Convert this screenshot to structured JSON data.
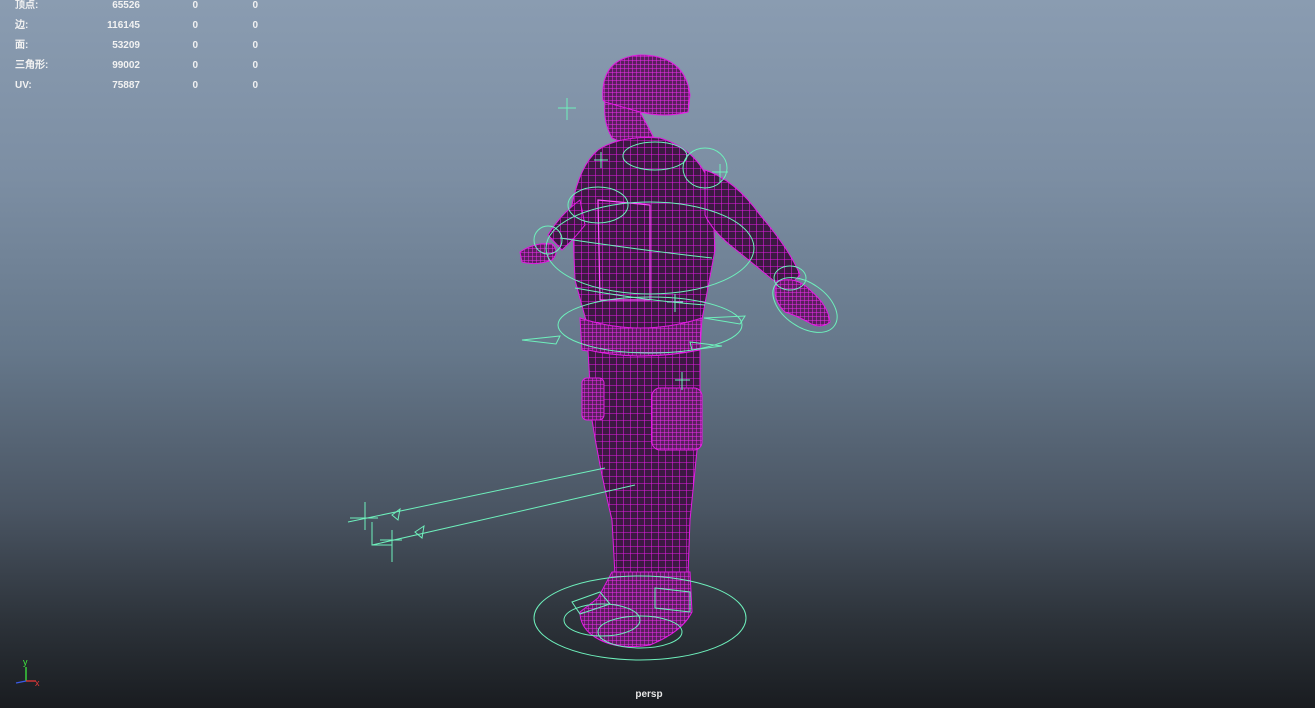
{
  "viewport": {
    "camera_name": "persp",
    "mesh_color": "#e21ce2",
    "control_color": "#6ef0bc"
  },
  "heads_up_display": {
    "rows": [
      {
        "label": "顶点:",
        "total": "65526",
        "selected": "0",
        "selected_object": "0"
      },
      {
        "label": "边:",
        "total": "116145",
        "selected": "0",
        "selected_object": "0"
      },
      {
        "label": "面:",
        "total": "53209",
        "selected": "0",
        "selected_object": "0"
      },
      {
        "label": "三角形:",
        "total": "99002",
        "selected": "0",
        "selected_object": "0"
      },
      {
        "label": "UV:",
        "total": "75887",
        "selected": "0",
        "selected_object": "0"
      }
    ]
  },
  "axis_gizmo": {
    "y_label": "y",
    "x_label": "x"
  }
}
